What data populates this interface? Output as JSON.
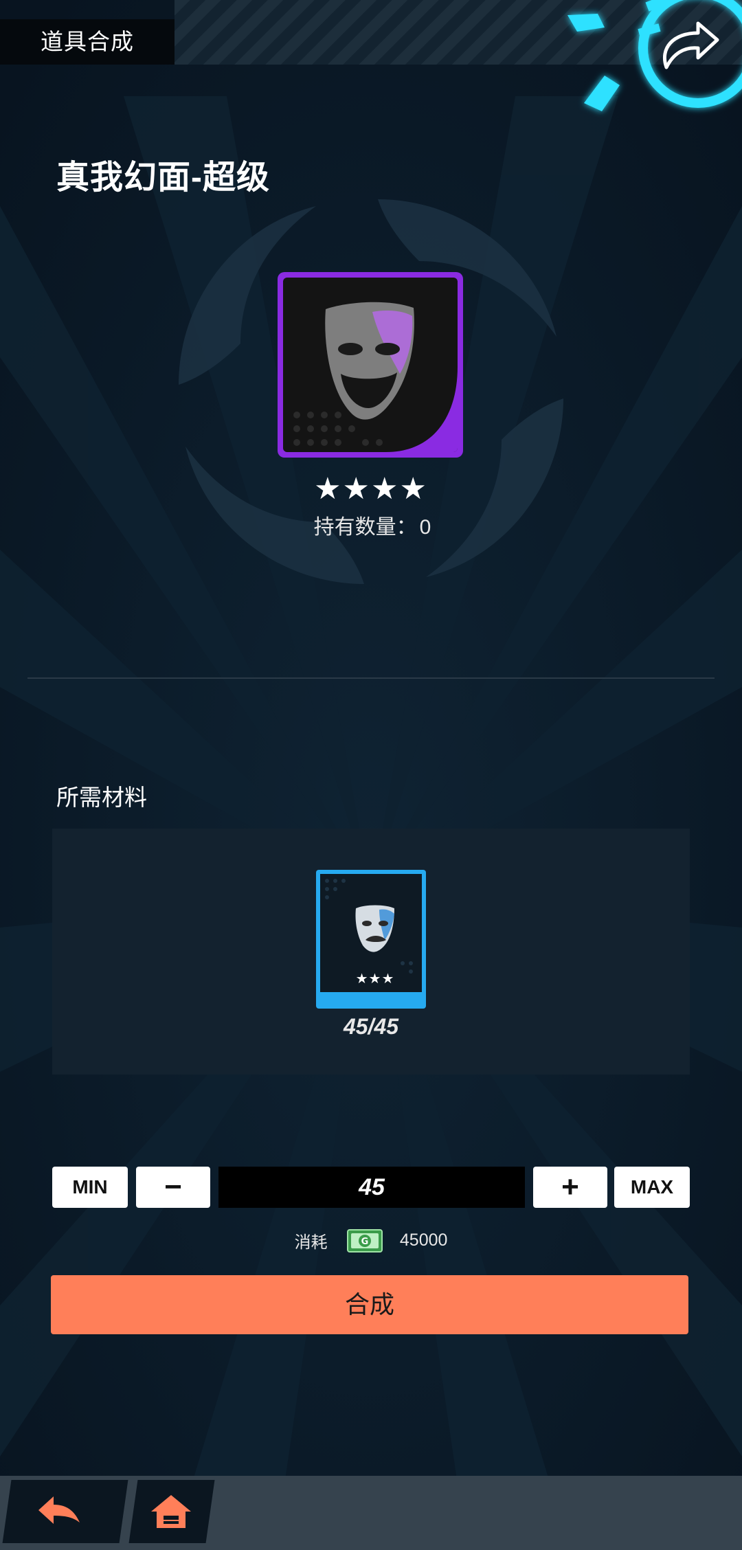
{
  "header": {
    "title": "道具合成"
  },
  "item": {
    "name": "真我幻面-超级",
    "stars": "★★★★",
    "owned_label": "持有数量：",
    "owned_value": "0"
  },
  "materials": {
    "title": "所需材料",
    "card_stars": "★★★",
    "count": "45/45"
  },
  "quantity": {
    "min_label": "MIN",
    "minus_label": "−",
    "value": "45",
    "plus_label": "+",
    "max_label": "MAX"
  },
  "cost": {
    "label": "消耗",
    "currency_icon": "gold-coin-icon",
    "value": "45000"
  },
  "action": {
    "synthesize_label": "合成"
  },
  "nav": {
    "back_icon": "back-arrow-icon",
    "home_icon": "home-icon"
  },
  "colors": {
    "accent": "#ff7f59",
    "rarity_purple": "#8a2be2",
    "rarity_blue": "#26aaf0",
    "background": "#0b1b29"
  }
}
